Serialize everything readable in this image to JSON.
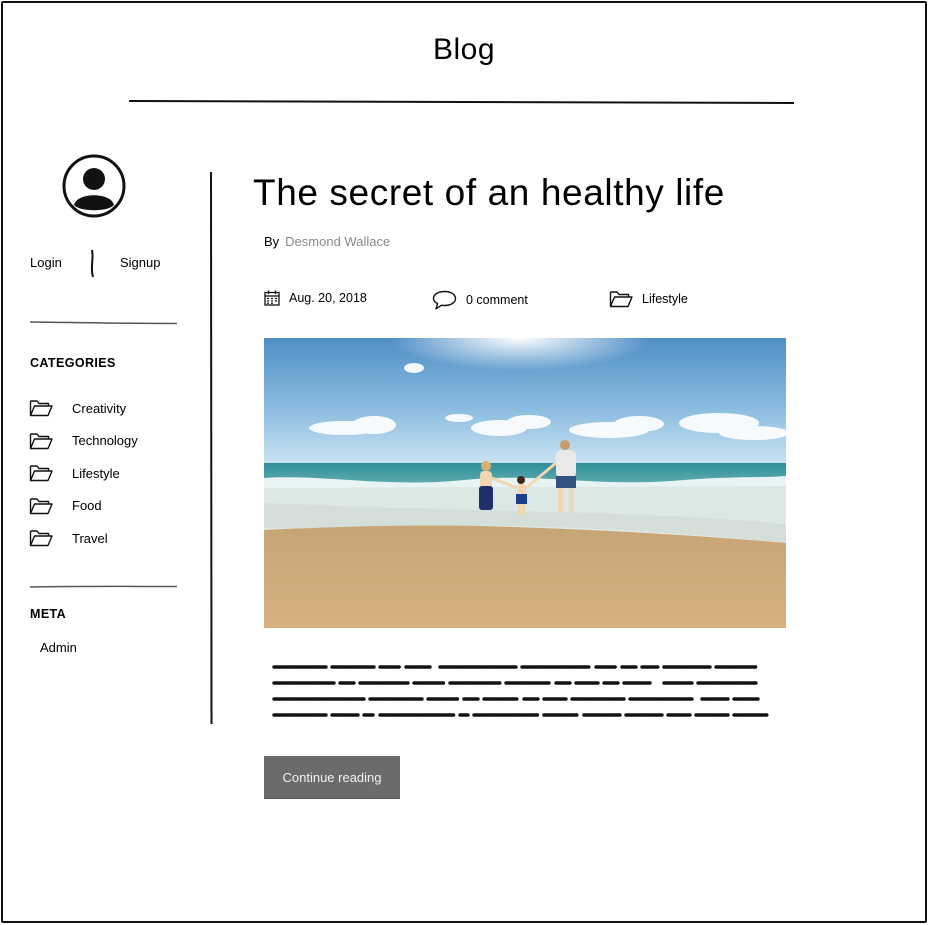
{
  "header": {
    "title": "Blog"
  },
  "sidebar": {
    "login_label": "Login",
    "signup_label": "Signup",
    "categories_title": "CATEGORIES",
    "categories": [
      {
        "label": "Creativity",
        "icon": "folder-icon"
      },
      {
        "label": "Technology",
        "icon": "folder-icon"
      },
      {
        "label": "Lifestyle",
        "icon": "folder-icon"
      },
      {
        "label": "Food",
        "icon": "folder-icon"
      },
      {
        "label": "Travel",
        "icon": "folder-icon"
      }
    ],
    "meta_title": "META",
    "meta_items": [
      {
        "label": "Admin"
      }
    ]
  },
  "post": {
    "title": "The secret of an healthy life",
    "by_label": "By",
    "author": "Desmond Wallace",
    "date": "Aug. 20, 2018",
    "comments": "0 comment",
    "category": "Lifestyle",
    "image_alt": "family at the beach",
    "continue_label": "Continue reading"
  }
}
